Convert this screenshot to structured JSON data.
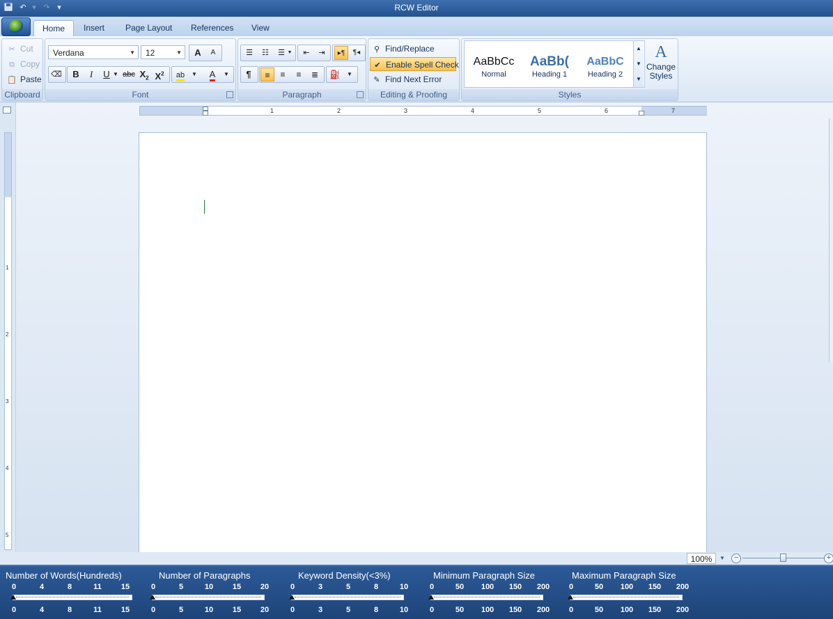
{
  "window": {
    "title": "RCW Editor"
  },
  "quick_access": {
    "save_icon": "save-icon",
    "undo_icon": "undo-icon",
    "redo_icon": "redo-icon",
    "customize_icon": "chevron-down-icon"
  },
  "tabs": [
    {
      "label": "Home",
      "active": true
    },
    {
      "label": "Insert",
      "active": false
    },
    {
      "label": "Page Layout",
      "active": false
    },
    {
      "label": "References",
      "active": false
    },
    {
      "label": "View",
      "active": false
    }
  ],
  "clipboard": {
    "label": "Clipboard",
    "cut": "Cut",
    "copy": "Copy",
    "paste": "Paste"
  },
  "font": {
    "label": "Font",
    "family": "Verdana",
    "size": "12",
    "grow": "A",
    "shrink": "A",
    "bold": "B",
    "italic": "I",
    "underline": "U",
    "strike": "abc"
  },
  "paragraph": {
    "label": "Paragraph",
    "pilcrow": "¶"
  },
  "editing": {
    "label": "Editing & Proofing",
    "find_replace": "Find/Replace",
    "spell_check": "Enable Spell Check",
    "find_next_error": "Find Next Error"
  },
  "styles": {
    "label": "Styles",
    "items": [
      {
        "preview": "AaBbCc",
        "name": "Normal"
      },
      {
        "preview": "AaBb(",
        "name": "Heading 1"
      },
      {
        "preview": "AaBbC",
        "name": "Heading 2"
      }
    ],
    "change_styles_line1": "Change",
    "change_styles_line2": "Styles"
  },
  "ruler": {
    "h_numbers": [
      "1",
      "2",
      "3",
      "4",
      "5",
      "6",
      "7"
    ],
    "v_numbers": [
      "1",
      "2",
      "3",
      "4",
      "5"
    ]
  },
  "zoom": {
    "value": "100%",
    "level_percent": 100
  },
  "colors": {
    "accent": "#f8c04e",
    "statusbar": "#23528f",
    "titlebar": "#2e5d9c"
  },
  "statusbar": {
    "meters": [
      {
        "title": "Number of Words(Hundreds)",
        "ticks": [
          "0",
          "4",
          "8",
          "11",
          "15"
        ],
        "value": 0
      },
      {
        "title": "Number of Paragraphs",
        "ticks": [
          "0",
          "5",
          "10",
          "15",
          "20"
        ],
        "value": 0
      },
      {
        "title": "Keyword Density(<3%)",
        "ticks": [
          "0",
          "3",
          "5",
          "8",
          "10"
        ],
        "value": 0
      },
      {
        "title": "Minimum Paragraph Size",
        "ticks": [
          "0",
          "50",
          "100",
          "150",
          "200"
        ],
        "value": 0
      },
      {
        "title": "Maximum Paragraph Size",
        "ticks": [
          "0",
          "50",
          "100",
          "150",
          "200"
        ],
        "value": 0
      }
    ]
  }
}
